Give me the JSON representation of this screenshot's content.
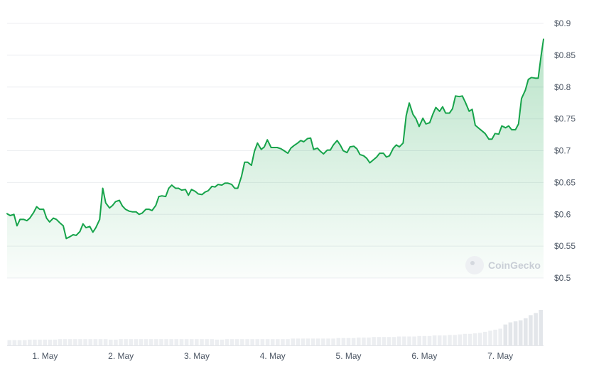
{
  "watermark": "CoinGecko",
  "chart_data": {
    "type": "area",
    "title": "",
    "xlabel": "",
    "ylabel": "",
    "ylim": [
      0.5,
      0.9
    ],
    "ytick_labels": [
      "$0.9",
      "$0.85",
      "$0.8",
      "$0.75",
      "$0.7",
      "$0.65",
      "$0.6",
      "$0.55",
      "$0.5"
    ],
    "ytick_values": [
      0.9,
      0.85,
      0.8,
      0.75,
      0.7,
      0.65,
      0.6,
      0.55,
      0.5
    ],
    "xtick_labels": [
      "1. May",
      "2. May",
      "3. May",
      "4. May",
      "5. May",
      "6. May",
      "7. May"
    ],
    "xtick_values": [
      0.5,
      1.5,
      2.5,
      3.5,
      4.5,
      5.5,
      6.5
    ],
    "x_range": [
      0,
      7.07
    ],
    "line_color": "#16a34a",
    "grid": true,
    "series": [
      {
        "values": [
          [
            0.0,
            0.601
          ],
          [
            0.04,
            0.598
          ],
          [
            0.09,
            0.6
          ],
          [
            0.13,
            0.582
          ],
          [
            0.17,
            0.592
          ],
          [
            0.22,
            0.592
          ],
          [
            0.26,
            0.59
          ],
          [
            0.3,
            0.594
          ],
          [
            0.35,
            0.603
          ],
          [
            0.39,
            0.612
          ],
          [
            0.43,
            0.608
          ],
          [
            0.48,
            0.608
          ],
          [
            0.52,
            0.594
          ],
          [
            0.56,
            0.588
          ],
          [
            0.61,
            0.594
          ],
          [
            0.65,
            0.592
          ],
          [
            0.7,
            0.586
          ],
          [
            0.74,
            0.582
          ],
          [
            0.78,
            0.562
          ],
          [
            0.83,
            0.565
          ],
          [
            0.87,
            0.568
          ],
          [
            0.91,
            0.567
          ],
          [
            0.96,
            0.573
          ],
          [
            1.0,
            0.585
          ],
          [
            1.04,
            0.579
          ],
          [
            1.09,
            0.581
          ],
          [
            1.13,
            0.572
          ],
          [
            1.17,
            0.579
          ],
          [
            1.22,
            0.592
          ],
          [
            1.26,
            0.641
          ],
          [
            1.3,
            0.618
          ],
          [
            1.35,
            0.61
          ],
          [
            1.39,
            0.614
          ],
          [
            1.43,
            0.62
          ],
          [
            1.48,
            0.622
          ],
          [
            1.52,
            0.613
          ],
          [
            1.56,
            0.608
          ],
          [
            1.61,
            0.605
          ],
          [
            1.65,
            0.604
          ],
          [
            1.7,
            0.604
          ],
          [
            1.74,
            0.6
          ],
          [
            1.78,
            0.602
          ],
          [
            1.83,
            0.608
          ],
          [
            1.87,
            0.608
          ],
          [
            1.91,
            0.606
          ],
          [
            1.96,
            0.614
          ],
          [
            2.0,
            0.628
          ],
          [
            2.04,
            0.629
          ],
          [
            2.09,
            0.628
          ],
          [
            2.13,
            0.641
          ],
          [
            2.17,
            0.646
          ],
          [
            2.22,
            0.641
          ],
          [
            2.26,
            0.641
          ],
          [
            2.3,
            0.638
          ],
          [
            2.35,
            0.639
          ],
          [
            2.39,
            0.63
          ],
          [
            2.43,
            0.639
          ],
          [
            2.48,
            0.636
          ],
          [
            2.52,
            0.632
          ],
          [
            2.57,
            0.631
          ],
          [
            2.61,
            0.635
          ],
          [
            2.65,
            0.637
          ],
          [
            2.7,
            0.644
          ],
          [
            2.74,
            0.643
          ],
          [
            2.78,
            0.647
          ],
          [
            2.83,
            0.646
          ],
          [
            2.87,
            0.649
          ],
          [
            2.91,
            0.649
          ],
          [
            2.96,
            0.647
          ],
          [
            3.0,
            0.641
          ],
          [
            3.04,
            0.641
          ],
          [
            3.09,
            0.66
          ],
          [
            3.13,
            0.682
          ],
          [
            3.17,
            0.682
          ],
          [
            3.22,
            0.677
          ],
          [
            3.26,
            0.699
          ],
          [
            3.3,
            0.712
          ],
          [
            3.35,
            0.702
          ],
          [
            3.39,
            0.706
          ],
          [
            3.43,
            0.717
          ],
          [
            3.48,
            0.705
          ],
          [
            3.52,
            0.705
          ],
          [
            3.56,
            0.705
          ],
          [
            3.61,
            0.703
          ],
          [
            3.65,
            0.7
          ],
          [
            3.7,
            0.696
          ],
          [
            3.74,
            0.704
          ],
          [
            3.78,
            0.708
          ],
          [
            3.83,
            0.712
          ],
          [
            3.87,
            0.716
          ],
          [
            3.91,
            0.714
          ],
          [
            3.96,
            0.719
          ],
          [
            4.0,
            0.72
          ],
          [
            4.04,
            0.702
          ],
          [
            4.09,
            0.704
          ],
          [
            4.13,
            0.699
          ],
          [
            4.17,
            0.695
          ],
          [
            4.22,
            0.701
          ],
          [
            4.26,
            0.701
          ],
          [
            4.3,
            0.709
          ],
          [
            4.35,
            0.716
          ],
          [
            4.39,
            0.709
          ],
          [
            4.43,
            0.7
          ],
          [
            4.48,
            0.697
          ],
          [
            4.52,
            0.706
          ],
          [
            4.57,
            0.707
          ],
          [
            4.61,
            0.703
          ],
          [
            4.65,
            0.694
          ],
          [
            4.7,
            0.692
          ],
          [
            4.74,
            0.688
          ],
          [
            4.78,
            0.681
          ],
          [
            4.83,
            0.686
          ],
          [
            4.87,
            0.69
          ],
          [
            4.91,
            0.696
          ],
          [
            4.96,
            0.696
          ],
          [
            5.0,
            0.69
          ],
          [
            5.04,
            0.692
          ],
          [
            5.09,
            0.704
          ],
          [
            5.13,
            0.709
          ],
          [
            5.17,
            0.706
          ],
          [
            5.22,
            0.712
          ],
          [
            5.26,
            0.755
          ],
          [
            5.3,
            0.775
          ],
          [
            5.35,
            0.757
          ],
          [
            5.39,
            0.75
          ],
          [
            5.43,
            0.738
          ],
          [
            5.48,
            0.751
          ],
          [
            5.52,
            0.742
          ],
          [
            5.57,
            0.744
          ],
          [
            5.61,
            0.757
          ],
          [
            5.65,
            0.768
          ],
          [
            5.7,
            0.762
          ],
          [
            5.74,
            0.769
          ],
          [
            5.78,
            0.759
          ],
          [
            5.83,
            0.759
          ],
          [
            5.87,
            0.766
          ],
          [
            5.91,
            0.786
          ],
          [
            5.96,
            0.785
          ],
          [
            6.0,
            0.786
          ],
          [
            6.04,
            0.776
          ],
          [
            6.09,
            0.762
          ],
          [
            6.13,
            0.765
          ],
          [
            6.17,
            0.74
          ],
          [
            6.22,
            0.735
          ],
          [
            6.26,
            0.731
          ],
          [
            6.3,
            0.727
          ],
          [
            6.35,
            0.718
          ],
          [
            6.39,
            0.718
          ],
          [
            6.43,
            0.727
          ],
          [
            6.48,
            0.726
          ],
          [
            6.52,
            0.739
          ],
          [
            6.57,
            0.736
          ],
          [
            6.61,
            0.739
          ],
          [
            6.65,
            0.733
          ],
          [
            6.7,
            0.733
          ],
          [
            6.74,
            0.742
          ],
          [
            6.78,
            0.782
          ],
          [
            6.83,
            0.795
          ],
          [
            6.87,
            0.812
          ],
          [
            6.91,
            0.815
          ],
          [
            6.96,
            0.814
          ],
          [
            7.0,
            0.814
          ],
          [
            7.04,
            0.851
          ],
          [
            7.07,
            0.875
          ]
        ]
      }
    ],
    "volume": [
      10,
      10,
      10,
      10,
      11,
      11,
      11,
      11,
      11,
      11,
      12,
      12,
      12,
      12,
      12,
      12,
      12,
      12,
      12,
      12,
      11,
      11,
      12,
      12,
      12,
      12,
      12,
      12,
      12,
      12,
      12,
      12,
      12,
      12,
      12,
      12,
      12,
      12,
      12,
      12,
      12,
      11,
      11,
      12,
      12,
      12,
      12,
      12,
      12,
      12,
      12,
      12,
      12,
      12,
      12,
      12,
      13,
      13,
      13,
      13,
      13,
      13,
      13,
      13,
      13,
      14,
      14,
      14,
      14,
      15,
      15,
      15,
      16,
      16,
      16,
      16,
      16,
      17,
      17,
      17,
      17,
      18,
      18,
      18,
      19,
      19,
      19,
      20,
      20,
      21,
      22,
      22,
      23,
      24,
      26,
      28,
      30,
      32,
      40,
      44,
      46,
      48,
      52,
      58,
      62,
      68
    ]
  }
}
